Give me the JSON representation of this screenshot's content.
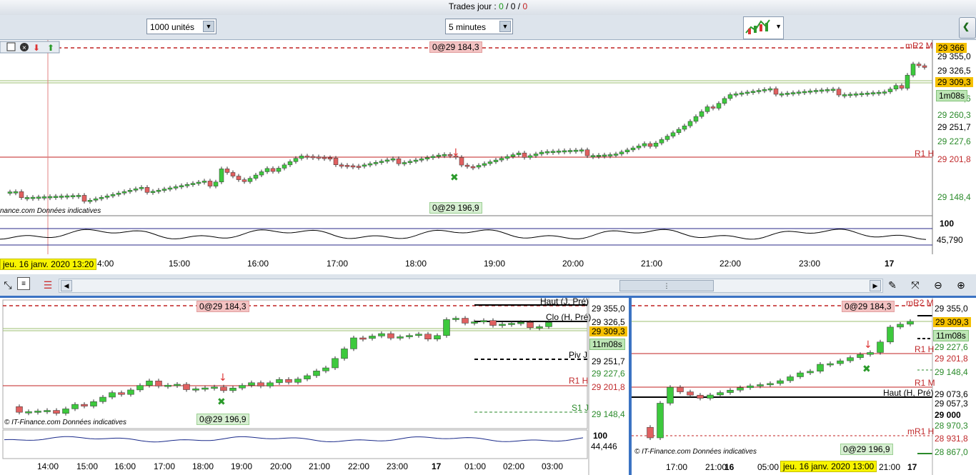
{
  "header": {
    "trades_label": "Trades jour : ",
    "trades_a": "0",
    "trades_sep1": " / ",
    "trades_b": "0",
    "trades_sep2": " / ",
    "trades_c": "0"
  },
  "toolbar": {
    "units": "1000 unités",
    "interval": "5 minutes"
  },
  "main_chart": {
    "order_label_top": "0@29 184,3",
    "order_label_bottom": "0@29 196,9",
    "credit": "nance.com  Données indicatives",
    "level_mr2": "mR2 M",
    "level_r1": "R1 H",
    "prices": [
      "29 366",
      "29 355,0",
      "29 326,5",
      "29 309,3",
      "1m08s",
      "29 299,6",
      "29 260,3",
      "29 251,7",
      "29 227,6",
      "29 201,8",
      "29 148,4"
    ],
    "indicator_top": "100",
    "indicator_val": "45,790",
    "date_badge": "jeu. 16 janv. 2020 13:20",
    "times": [
      "4:00",
      "15:00",
      "16:00",
      "17:00",
      "18:00",
      "19:00",
      "20:00",
      "21:00",
      "22:00",
      "23:00",
      "17"
    ]
  },
  "bottom_left": {
    "order_label_top": "0@29 184,3",
    "order_label_bottom": "0@29 196,9",
    "credit": "© IT-Finance.com  Données indicatives",
    "lbl_haut": "Haut (J, Pré)",
    "lbl_clo": "Clo (H, Pré)",
    "lbl_piv": "Piv J",
    "lbl_r1": "R1 H",
    "lbl_s1": "S1 J",
    "prices": [
      "29 355,0",
      "29 326,5",
      "29 309,3",
      "11m08s",
      "29 251,7",
      "29 227,6",
      "29 201,8",
      "29 148,4"
    ],
    "indicator_top": "100",
    "indicator_val": "44,446",
    "times": [
      "14:00",
      "15:00",
      "16:00",
      "17:00",
      "18:00",
      "19:00",
      "20:00",
      "21:00",
      "22:00",
      "23:00",
      "17",
      "01:00",
      "02:00",
      "03:00"
    ]
  },
  "bottom_right": {
    "order_label_top": "0@29 184,3",
    "order_label_bottom": "0@29 196,9",
    "credit": "© IT-Finance.com  Données indicatives",
    "lbl_mr2": "mR2 M",
    "lbl_r1h": "R1 H",
    "lbl_r1m": "R1 M",
    "lbl_haut": "Haut (H, Pré)",
    "lbl_mr1": "mR1 H",
    "prices": [
      "29 355,0",
      "29 309,3",
      "11m08s",
      "29 227,6",
      "29 201,8",
      "29 148,4",
      "29 073,6",
      "29 057,3",
      "29 000",
      "28 970,3",
      "28 931,8",
      "28 867,0"
    ],
    "date_badge": "jeu. 16 janv. 2020 13:00",
    "times": [
      "17:00",
      "21:00",
      "16",
      "05:00",
      "21:00",
      "17"
    ]
  },
  "colors": {
    "bull": "#3dc93d",
    "bear": "#e06060",
    "resistance": "#c02020",
    "accent": "#3b73c3"
  }
}
